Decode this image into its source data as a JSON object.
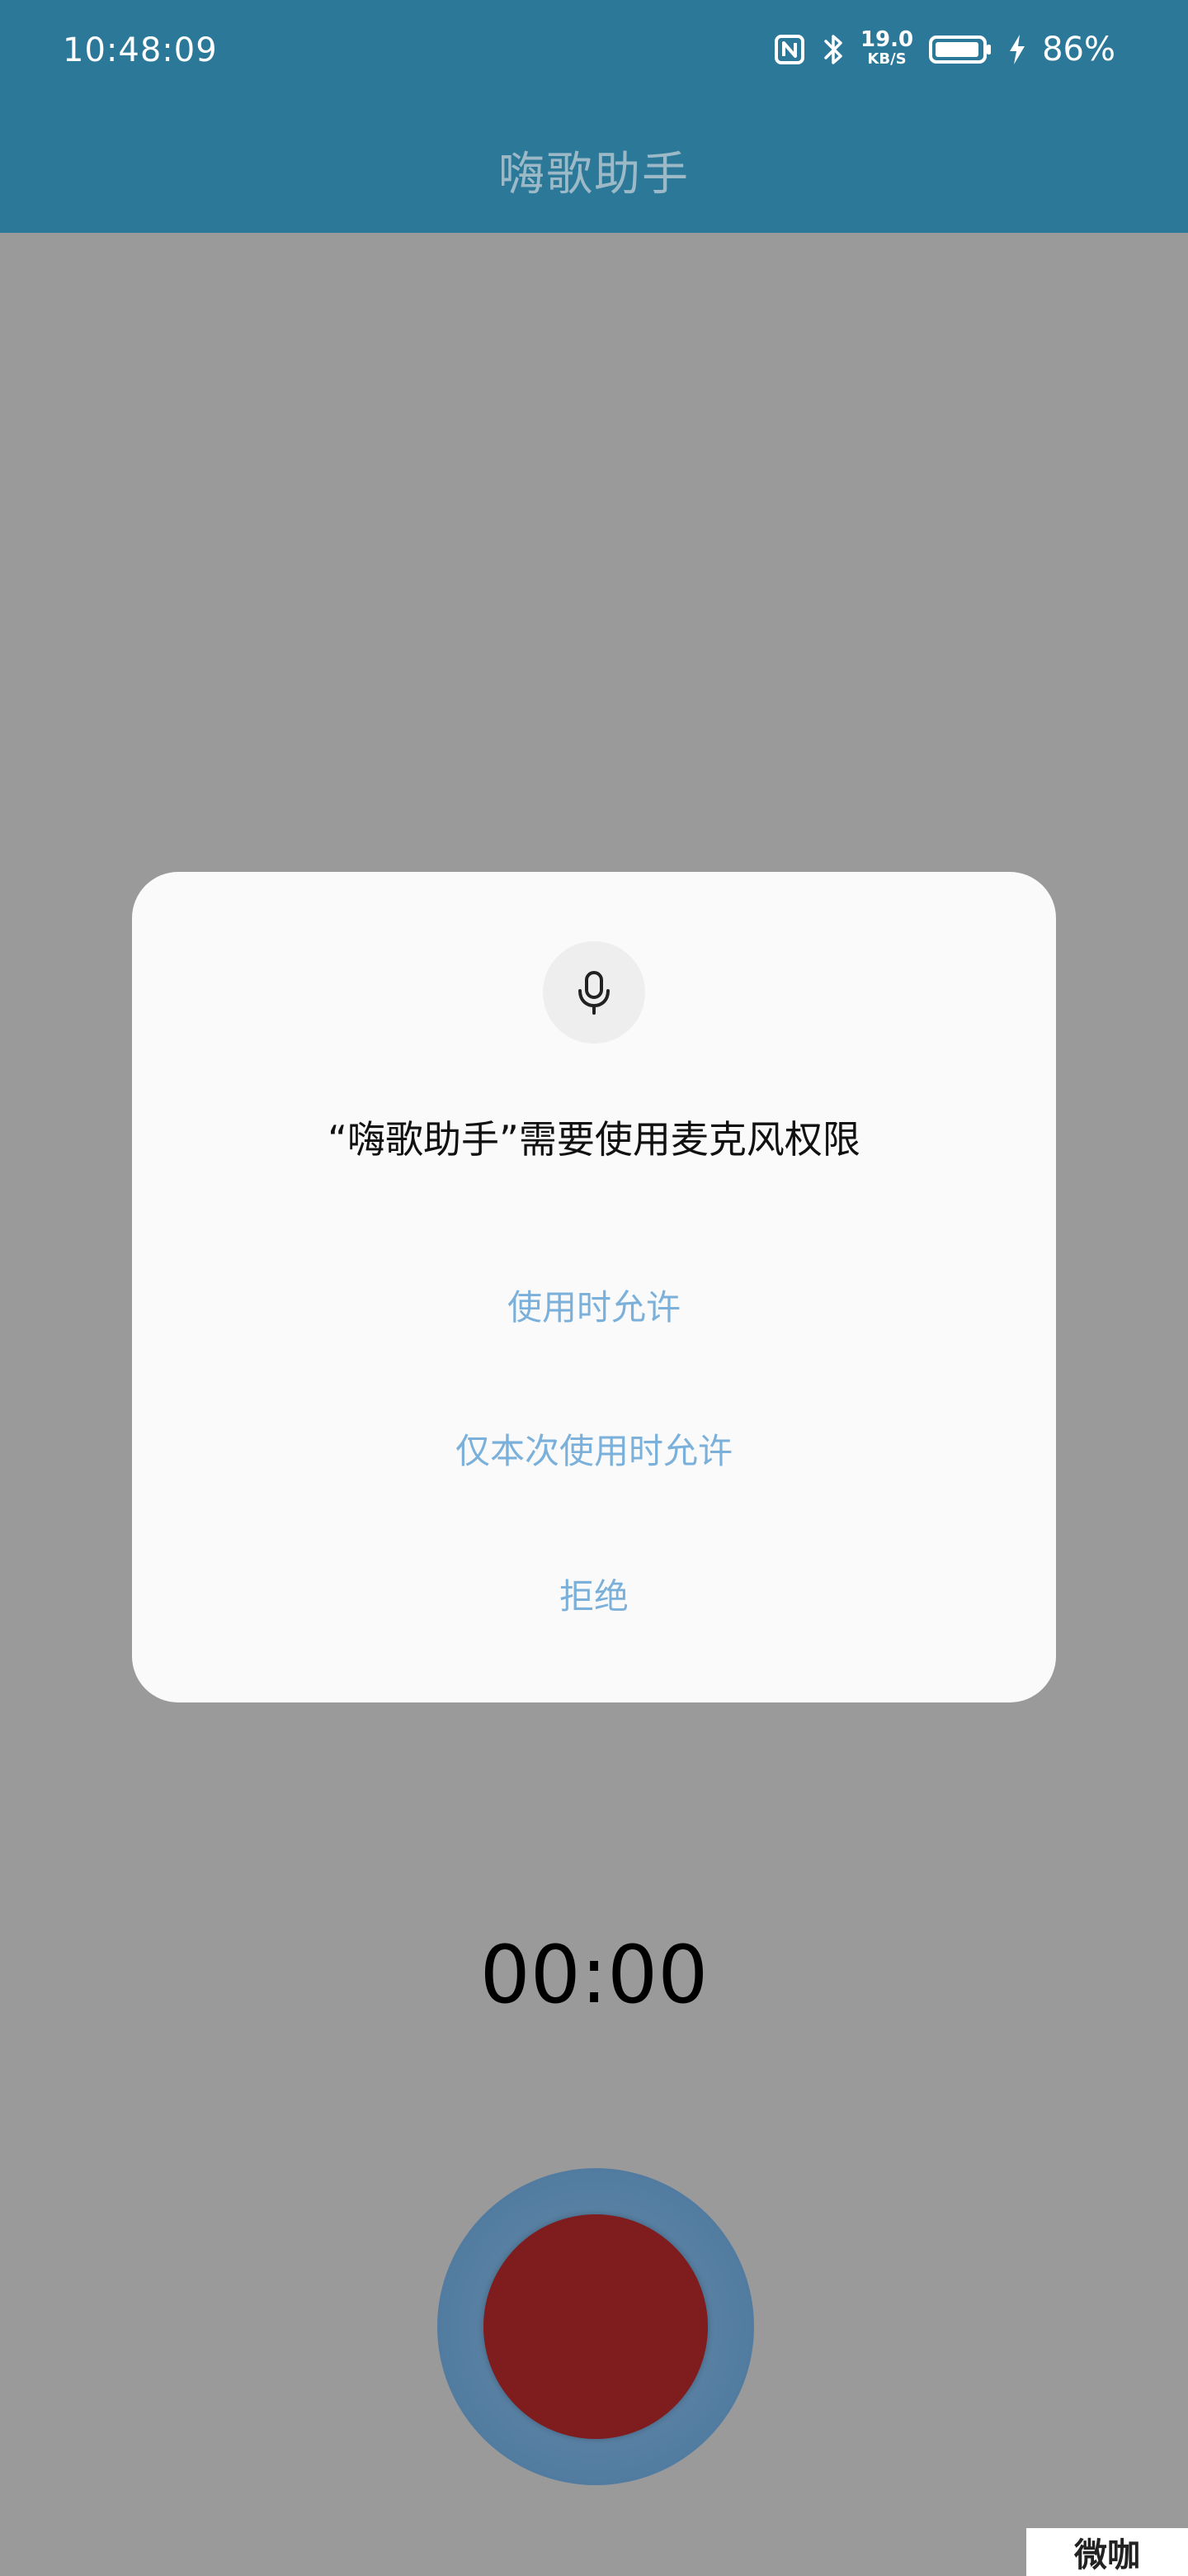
{
  "status_bar": {
    "time": "10:48:09",
    "net_speed_value": "19.0",
    "net_speed_unit": "KB/S",
    "battery_percent": "86%",
    "icons": [
      "nfc-icon",
      "bluetooth-icon",
      "battery-icon",
      "charging-icon"
    ]
  },
  "app_bar": {
    "title": "嗨歌助手"
  },
  "recorder": {
    "timer": "00:00",
    "record_color": "#7f1c1d"
  },
  "dialog": {
    "icon": "microphone-icon",
    "title": "“嗨歌助手”需要使用麦克风权限",
    "options": [
      {
        "label": "使用时允许"
      },
      {
        "label": "仅本次使用时允许"
      },
      {
        "label": "拒绝"
      }
    ],
    "accent_color": "#7ab0d9"
  },
  "watermark": {
    "text": "微咖"
  }
}
